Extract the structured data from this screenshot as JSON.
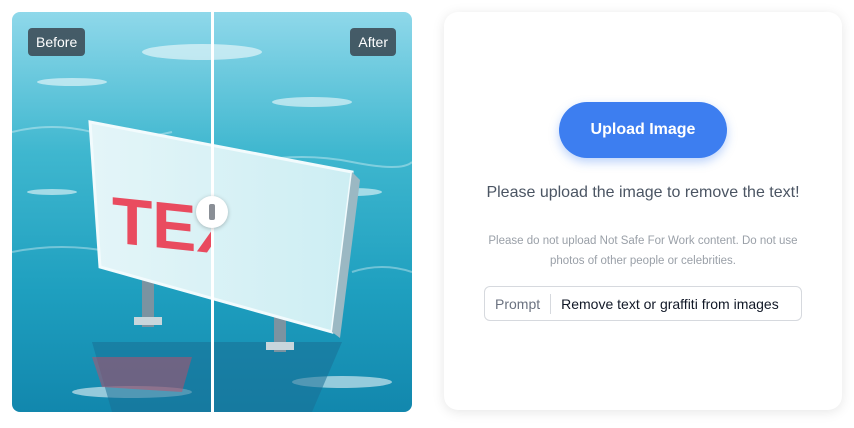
{
  "comparison": {
    "before_label": "Before",
    "after_label": "After",
    "sign_text": "TEX",
    "slider_position": 0.5
  },
  "upload": {
    "button_label": "Upload Image",
    "instruction": "Please upload the image to remove the text!",
    "notice": "Please do not upload Not Safe For Work content. Do not use photos of other people or celebrities."
  },
  "prompt": {
    "label": "Prompt",
    "value": "Remove text or graffiti from images"
  },
  "colors": {
    "accent": "#3d7ef0",
    "water": "#2fb6c9",
    "sign_text": "#e94b5f"
  }
}
